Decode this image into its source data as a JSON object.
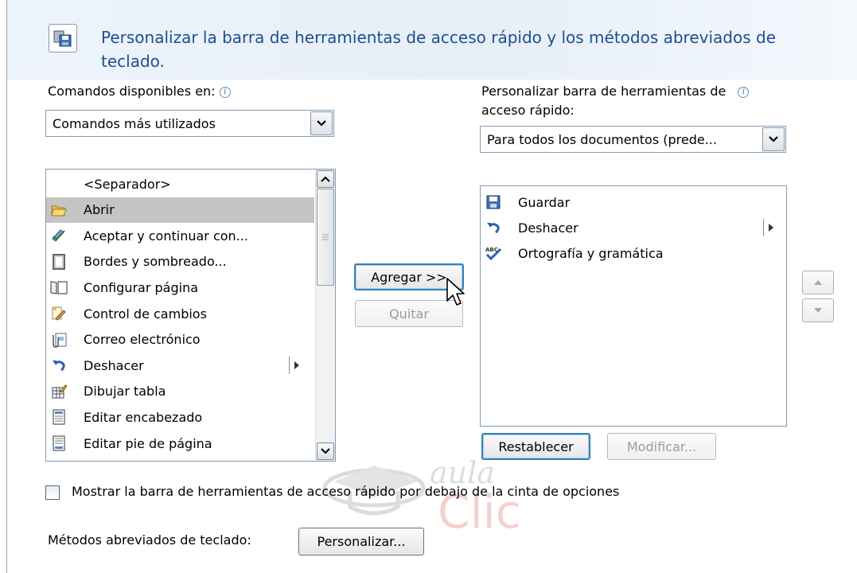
{
  "header": {
    "title": "Personalizar la barra de herramientas de acceso rápido y los métodos abreviados de teclado."
  },
  "left": {
    "label": "Comandos disponibles en:",
    "combo_value": "Comandos más utilizados",
    "items": [
      {
        "label": "<Separador>",
        "icon": "none"
      },
      {
        "label": "Abrir",
        "icon": "open-folder-icon",
        "selected": true
      },
      {
        "label": "Aceptar y continuar con...",
        "icon": "accept-changes-icon"
      },
      {
        "label": "Bordes y sombreado...",
        "icon": "borders-shading-icon"
      },
      {
        "label": "Configurar página",
        "icon": "page-setup-icon"
      },
      {
        "label": "Control de cambios",
        "icon": "track-changes-icon"
      },
      {
        "label": "Correo electrónico",
        "icon": "email-icon"
      },
      {
        "label": "Deshacer",
        "icon": "undo-icon",
        "submenu": true
      },
      {
        "label": "Dibujar tabla",
        "icon": "draw-table-icon"
      },
      {
        "label": "Editar encabezado",
        "icon": "edit-header-icon"
      },
      {
        "label": "Editar pie de página",
        "icon": "edit-footer-icon"
      }
    ]
  },
  "middle": {
    "add_label": "Agregar >>",
    "remove_label": "Quitar"
  },
  "right": {
    "label_line1": "Personalizar barra de herramientas de",
    "label_line2": "acceso rápido:",
    "combo_value": "Para todos los documentos (prede...",
    "items": [
      {
        "label": "Guardar",
        "icon": "save-icon"
      },
      {
        "label": "Deshacer",
        "icon": "undo-icon",
        "submenu": true
      },
      {
        "label": "Ortografía y gramática",
        "icon": "spelling-grammar-icon"
      }
    ],
    "reset_label": "Restablecer",
    "modify_label": "Modificar..."
  },
  "footer": {
    "checkbox_label": "Mostrar la barra de herramientas de acceso rápido por debajo de la cinta de opciones",
    "checkbox_checked": false,
    "shortcuts_label": "Métodos abreviados de teclado:",
    "customize_label": "Personalizar..."
  },
  "watermark": {
    "line1": "aula",
    "line2": "Clic"
  },
  "colors": {
    "title": "#1f4e8f",
    "selection": "#c4c4c4",
    "default_button_border": "#3c7fb1",
    "header_background": "#e6eef8"
  }
}
